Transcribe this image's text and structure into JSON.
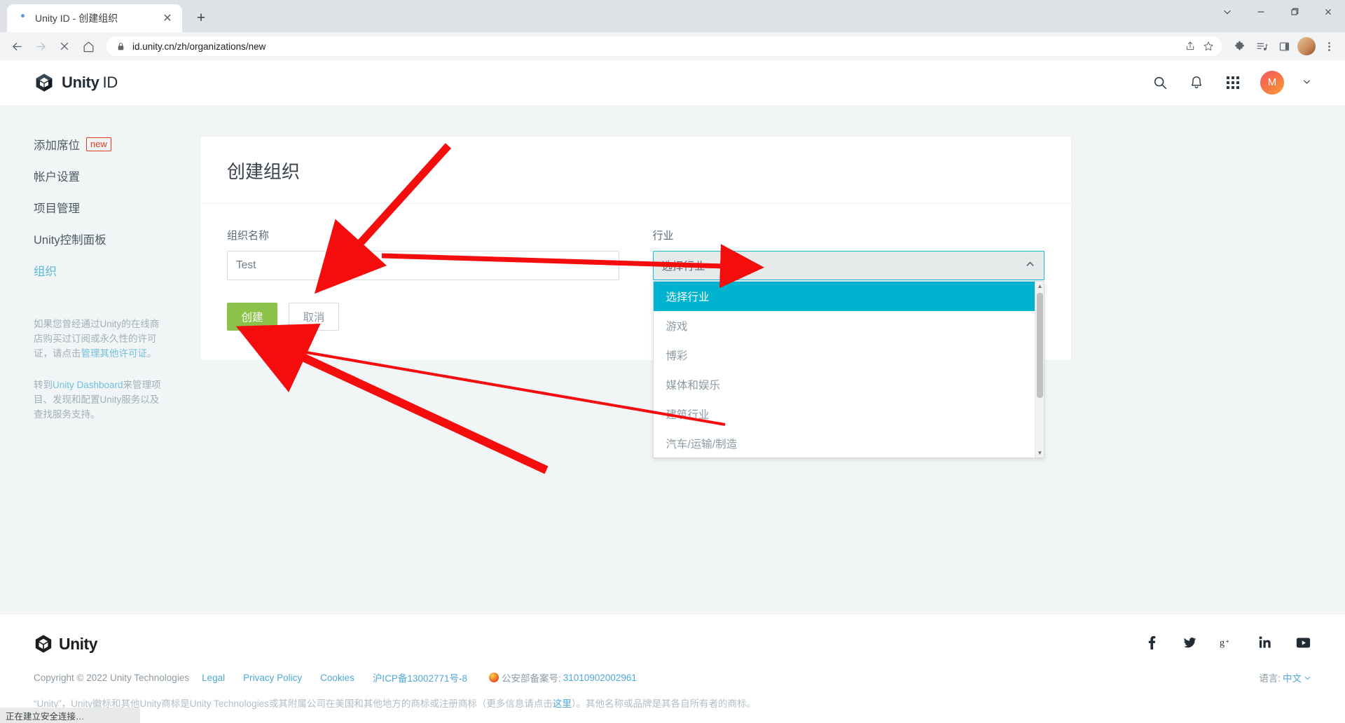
{
  "browser": {
    "tab_title": "Unity ID - 创建组织",
    "url": "id.unity.cn/zh/organizations/new",
    "new_tab_label": "+",
    "close_tab_label": "✕",
    "window_controls": {
      "minimize": "—",
      "maximize": "❐",
      "close": "✕",
      "expand": "⌄"
    },
    "status_text": "正在建立安全连接…"
  },
  "header": {
    "brand_bold": "Unity",
    "brand_light": "ID",
    "avatar_initial": "M"
  },
  "sidebar": {
    "items": [
      {
        "label": "添加席位",
        "badge": "new",
        "active": false
      },
      {
        "label": "帐户设置",
        "badge": "",
        "active": false
      },
      {
        "label": "项目管理",
        "badge": "",
        "active": false
      },
      {
        "label": "Unity控制面板",
        "badge": "",
        "active": false
      },
      {
        "label": "组织",
        "badge": "",
        "active": true
      }
    ],
    "note1_a": "如果您曾经通过Unity的在线商店购买过订阅或永久性的许可证，请点击",
    "note1_link": "管理其他许可证",
    "note1_b": "。",
    "note2_a": "转到",
    "note2_link": "Unity Dashboard",
    "note2_b": "来管理项目、发现和配置Unity服务以及查找服务支持。"
  },
  "main": {
    "card_title": "创建组织",
    "org_name_label": "组织名称",
    "org_name_value": "Test",
    "org_name_placeholder": "组织名称",
    "industry_label": "行业",
    "industry_selected": "选择行业",
    "industry_options": [
      "选择行业",
      "游戏",
      "博彩",
      "媒体和娱乐",
      "建筑行业",
      "汽车/运输/制造"
    ],
    "create_button": "创建",
    "cancel_button": "取消"
  },
  "footer": {
    "logo_text": "Unity",
    "copyright": "Copyright © 2022 Unity Technologies",
    "links": [
      "Legal",
      "Privacy Policy",
      "Cookies",
      "沪ICP备13002771号-8"
    ],
    "police_label": "公安部备案号:",
    "police_number": "31010902002961",
    "social": [
      "f",
      "twitter",
      "g+",
      "in",
      "youtube"
    ],
    "language_label": "语言:",
    "language_value": "中文",
    "trademark_a": "“Unity”，Unity徽标和其他Unity商标是Unity Technologies或其附属公司在美国和其他地方的商标或注册商标（更多信息请点击",
    "trademark_link": "这里",
    "trademark_b": "）。其他名称或品牌是其各自所有者的商标。"
  },
  "colors": {
    "accent_cyan": "#00b4d0",
    "create_green": "#8bc34a",
    "link_blue": "#4fa8d8",
    "annotation_red": "#f50d0d",
    "badge_red": "#e03b24"
  }
}
